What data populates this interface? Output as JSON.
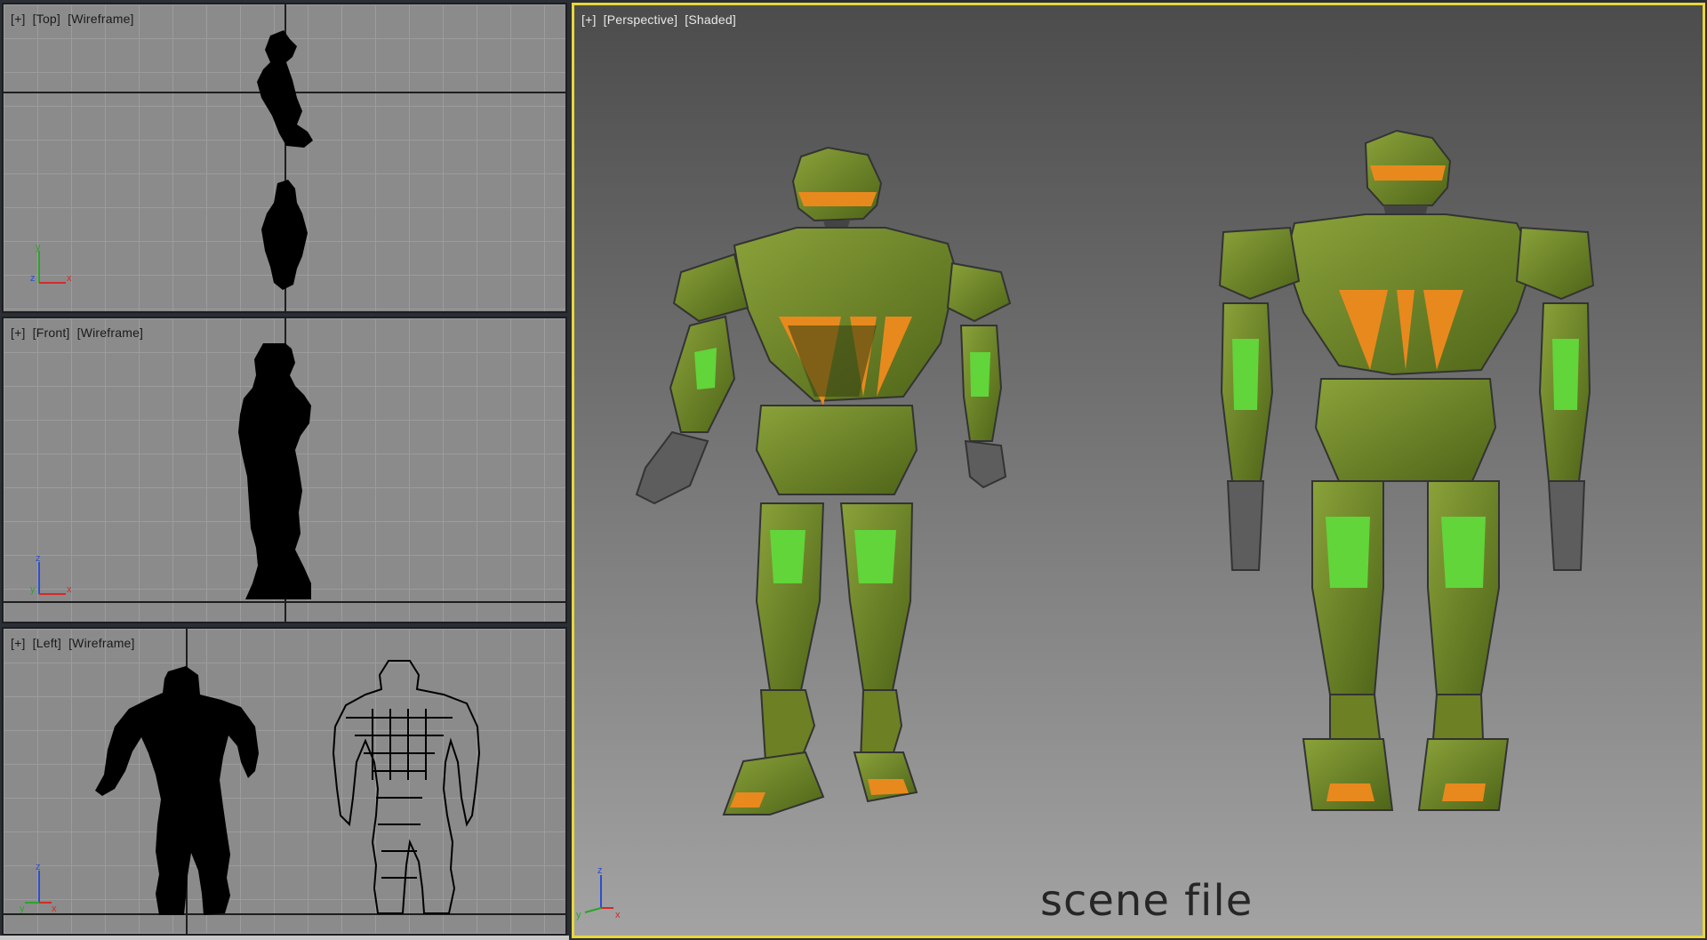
{
  "viewports": {
    "top": {
      "plus": "[+]",
      "view": "[Top]",
      "mode": "[Wireframe]"
    },
    "front": {
      "plus": "[+]",
      "view": "[Front]",
      "mode": "[Wireframe]"
    },
    "left": {
      "plus": "[+]",
      "view": "[Left]",
      "mode": "[Wireframe]"
    },
    "persp": {
      "plus": "[+]",
      "view": "[Perspective]",
      "mode": "[Shaded]"
    }
  },
  "axis_labels": {
    "top": {
      "vertical": "y",
      "depth": "z",
      "horizontal": "x"
    },
    "front": {
      "vertical": "z",
      "depth": "y",
      "horizontal": "x"
    },
    "left": {
      "vertical": "z",
      "depth": "y",
      "horizontal": "x"
    },
    "persp": {
      "vertical": "z",
      "depth": "y",
      "horizontal": "x"
    }
  },
  "caption": "scene file",
  "colors": {
    "active_border": "#e7d73a",
    "viewport_grid_bg": "#8b8b8b",
    "axis_x": "#d42a2a",
    "axis_y": "#2aa52a",
    "axis_z": "#2a4ed4",
    "robot_green": "#6f8a2a",
    "robot_orange": "#e8891e"
  }
}
